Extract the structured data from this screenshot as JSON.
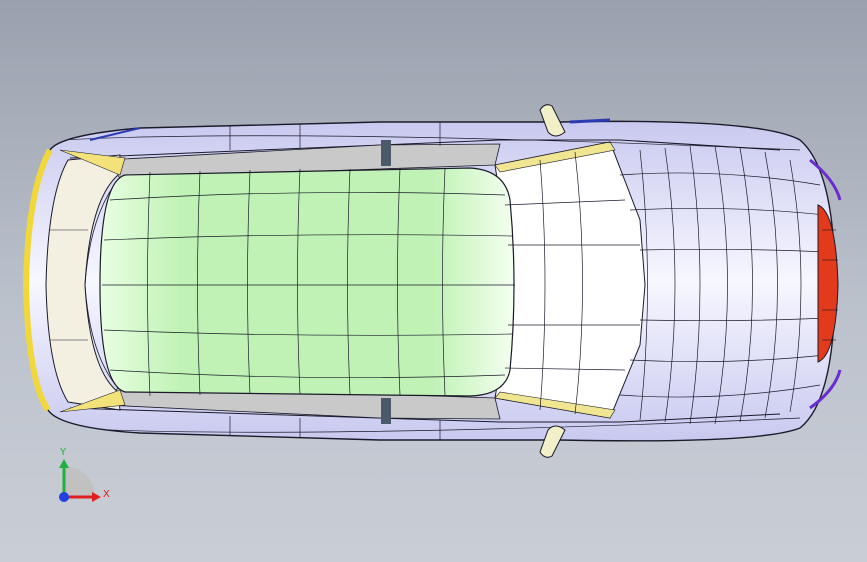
{
  "viewport": {
    "background_top": "#9aa1ae",
    "background_bottom": "#c9ced6",
    "view": "top",
    "model": {
      "body_color": "#e9e9f7",
      "body_edge_color": "#b8b8e6",
      "roof_color": "#c8f5c0",
      "windshield_color": "#ffffff",
      "rear_glass_color": "#f0efe0",
      "trim_color": "#efe58a",
      "tail_light_color": "#e23a1a",
      "mirror_color": "#f2f0c8",
      "pillar_color": "#4a5a6a",
      "wire_color": "#1a1a1a"
    }
  },
  "triad": {
    "x_label": "X",
    "y_label": "Y",
    "x_color": "#e02020",
    "y_color": "#20b040",
    "z_color": "#2040e0"
  }
}
